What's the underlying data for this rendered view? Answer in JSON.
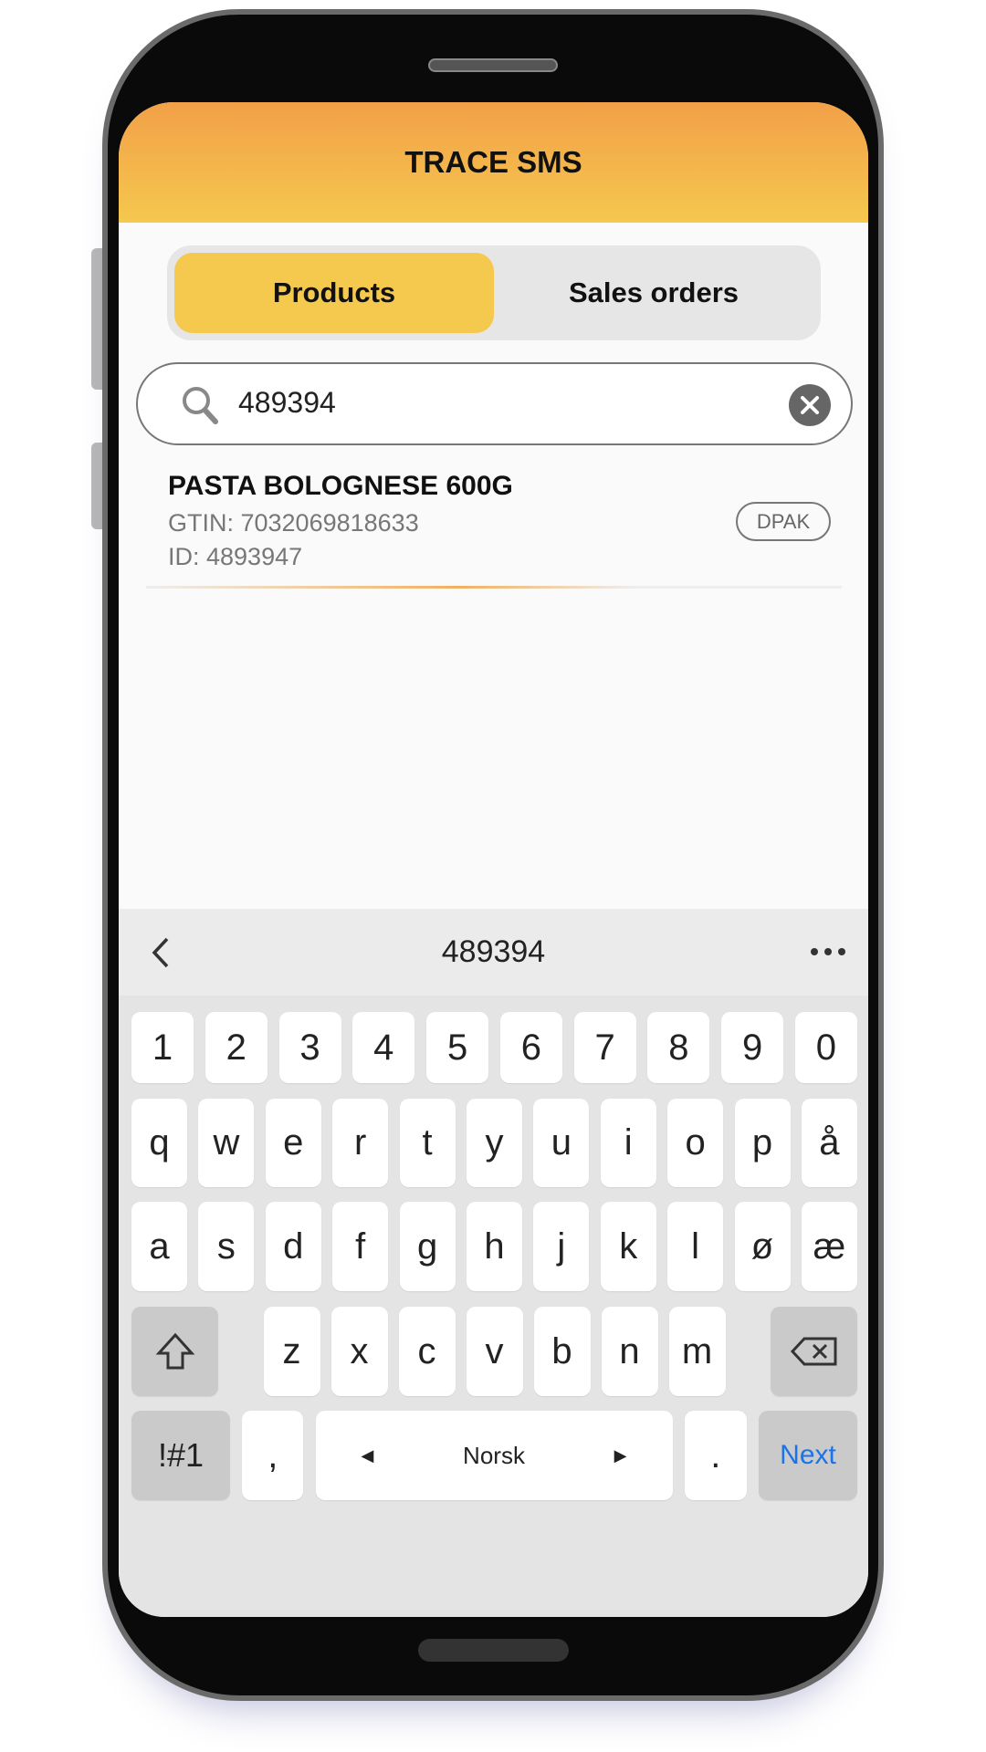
{
  "app": {
    "title": "TRACE SMS"
  },
  "tabs": [
    {
      "label": "Products",
      "active": true
    },
    {
      "label": "Sales orders",
      "active": false
    }
  ],
  "search": {
    "value": "489394",
    "icon": "search-icon",
    "clear_icon": "close-icon"
  },
  "results": [
    {
      "name": "PASTA BOLOGNESE 600G",
      "gtin": "GTIN: 7032069818633",
      "id": "ID: 4893947",
      "badge": "DPAK"
    }
  ],
  "keyboard": {
    "suggestion": "489394",
    "numbers": [
      "1",
      "2",
      "3",
      "4",
      "5",
      "6",
      "7",
      "8",
      "9",
      "0"
    ],
    "row1": [
      "q",
      "w",
      "e",
      "r",
      "t",
      "y",
      "u",
      "i",
      "o",
      "p",
      "å"
    ],
    "row2": [
      "a",
      "s",
      "d",
      "f",
      "g",
      "h",
      "j",
      "k",
      "l",
      "ø",
      "æ"
    ],
    "row3": [
      "z",
      "x",
      "c",
      "v",
      "b",
      "n",
      "m"
    ],
    "symbols_label": "!#1",
    "comma": ",",
    "space_label": "Norsk",
    "period": ".",
    "action_label": "Next",
    "action_color": "#1a73e8"
  },
  "colors": {
    "accent": "#f5c84e",
    "header_top": "#f2a048"
  }
}
